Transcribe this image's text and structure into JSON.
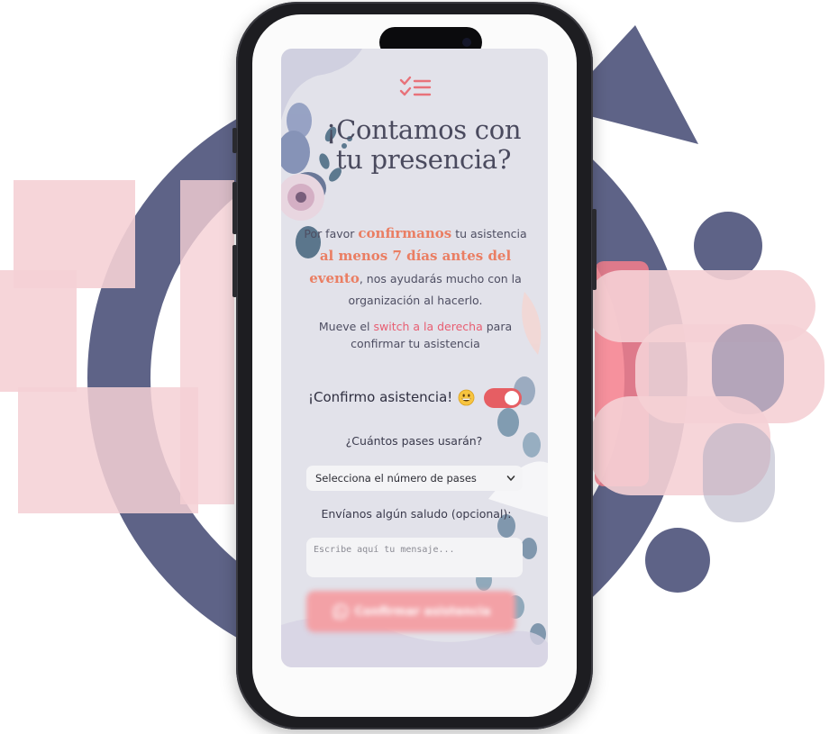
{
  "screen": {
    "title": "¡Contamos con tu presencia?",
    "intro": {
      "t1": "Por favor ",
      "h1": "confirmanos",
      "t2": " tu asistencia ",
      "h2": "al menos 7 días antes del evento",
      "t3": ", nos ayudarás mucho con la organización al hacerlo."
    },
    "instruction": {
      "t1": "Mueve el ",
      "h1": "switch a la derecha",
      "t2": " para confirmar tu asistencia"
    },
    "confirm_label": "¡Confirmo asistencia!",
    "confirm_toggle_on": true,
    "passes_label": "¿Cuántos pases usarán?",
    "passes_select_value": "Selecciona el número de pases",
    "message_label": "Envíanos algún saludo (opcional):",
    "message_placeholder": "Escribe aquí tu mensaje...",
    "send_label": "Confirmar asistencia"
  },
  "icons": {
    "header": "checklist-icon",
    "emoji": "grinning-face-icon",
    "select": "chevron-down-icon",
    "send": "whatsapp-icon"
  },
  "colors": {
    "accent": "#ea7e63",
    "pink": "#e85e72",
    "toggle": "#e65e63",
    "navy": "#5e6387",
    "blush": "#f5d0d5"
  }
}
